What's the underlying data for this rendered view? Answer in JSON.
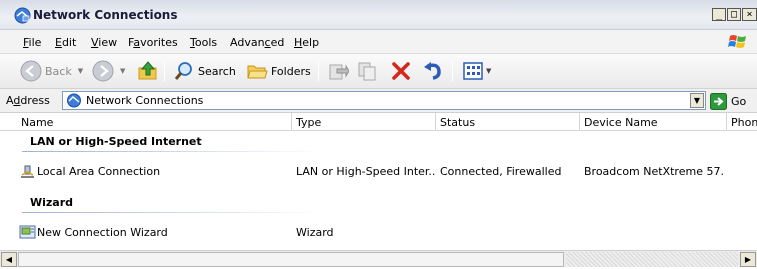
{
  "window": {
    "title": "Network Connections"
  },
  "menu": [
    {
      "key": "F",
      "rest": "ile"
    },
    {
      "key": "E",
      "rest": "dit"
    },
    {
      "key": "V",
      "rest": "iew"
    },
    {
      "pre": "F",
      "key": "a",
      "rest": "vorites"
    },
    {
      "key": "T",
      "rest": "ools"
    },
    {
      "pre": "Advan",
      "key": "c",
      "rest": "ed"
    },
    {
      "key": "H",
      "rest": "elp"
    }
  ],
  "toolbar": {
    "back_label": "Back",
    "search_label": "Search",
    "folders_label": "Folders"
  },
  "address": {
    "label_pre": "A",
    "label_key": "d",
    "label_rest": "dress",
    "value": "Network Connections",
    "go_label": "Go"
  },
  "columns": [
    "Name",
    "Type",
    "Status",
    "Device Name",
    "Phone"
  ],
  "groups": [
    {
      "title": "LAN or High-Speed Internet",
      "items": [
        {
          "name": "Local Area Connection",
          "type": "LAN or High-Speed Inter...",
          "status": "Connected, Firewalled",
          "device": "Broadcom NetXtreme 57...",
          "icon": "network-connection-icon"
        }
      ]
    },
    {
      "title": "Wizard",
      "items": [
        {
          "name": "New Connection Wizard",
          "type": "Wizard",
          "status": "",
          "device": "",
          "icon": "wizard-icon"
        }
      ]
    }
  ],
  "colors": {
    "accent": "#2c5bb8",
    "delete_red": "#d9261c",
    "go_green": "#2e9a3c"
  }
}
